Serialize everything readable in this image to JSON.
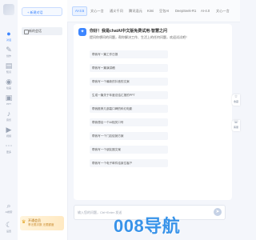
{
  "rail": {
    "items": [
      {
        "label": "对话",
        "icon": "chat-icon"
      },
      {
        "label": "创作",
        "icon": "pen-icon"
      },
      {
        "label": "知识",
        "icon": "book-icon"
      },
      {
        "label": "绘画",
        "icon": "palette-icon"
      },
      {
        "label": "PPT",
        "icon": "slides-icon"
      },
      {
        "label": "音乐",
        "icon": "music-icon"
      },
      {
        "label": "视频",
        "icon": "video-icon"
      },
      {
        "label": "更多",
        "icon": "more-icon"
      }
    ],
    "bottom": [
      {
        "label": "AI搜索",
        "icon": "search-icon"
      },
      {
        "label": "设置",
        "icon": "moon-icon"
      }
    ]
  },
  "sidebar": {
    "new_chat": "+ 新建对话",
    "session": "新的会话"
  },
  "promo": {
    "title": "开通会员",
    "subtitle": "享无限次数 无限额度"
  },
  "tabs": [
    "AI-3.5",
    "文心一言",
    "通义千问",
    "腾讯混元",
    "Kimi",
    "豆包AI",
    "DeepSeek-R1",
    "AI-4.0",
    "文心一言"
  ],
  "chat": {
    "greeting_title": "你好！我是chatAI中文版免费试用-智慧之问",
    "greeting_sub": "提问你想问的问题，帮你解决工作、生活上的任何问题，欢迎试试吧！",
    "suggestions": [
      "帮我写一篇工作日报",
      "帮我写一篇演讲稿",
      "帮我写一个最新的抖音的文案",
      "生成一篇关于年度总结汇报的PPT",
      "帮我推荐几部高口碑的科幻电影",
      "帮我想出一个AI相关口号",
      "帮我写一个门店促销方案",
      "帮我写一个朋友圈文案",
      "帮我写一个电子邮件给某位客户"
    ]
  },
  "input": {
    "placeholder": "输入您的问题，Ctrl+Enter 发送"
  },
  "floating": [
    {
      "label": "收藏",
      "icon": "star-icon"
    },
    {
      "label": "客服",
      "icon": "headset-icon"
    }
  ],
  "watermark": "008导航",
  "colors": {
    "accent": "#3d86ff",
    "watermark": "#1c84e6"
  }
}
